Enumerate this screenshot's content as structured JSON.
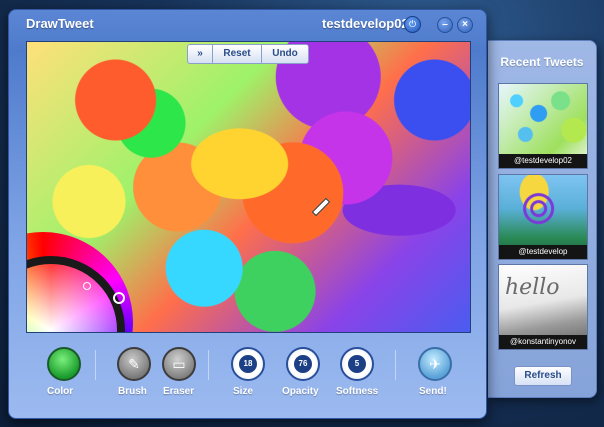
{
  "app": {
    "title": "DrawTweet",
    "username": "testdevelop02"
  },
  "canvas_toolbar": {
    "more": "»",
    "reset": "Reset",
    "undo": "Undo"
  },
  "tools": {
    "color": "Color",
    "brush": "Brush",
    "eraser": "Eraser",
    "size": {
      "label": "Size",
      "value": "18"
    },
    "opacity": {
      "label": "Opacity",
      "value": "76"
    },
    "softness": {
      "label": "Softness",
      "value": "5"
    },
    "send": "Send!"
  },
  "recent": {
    "title": "Recent Tweets",
    "items": [
      {
        "user": "@testdevelop02"
      },
      {
        "user": "@testdevelop"
      },
      {
        "user": "@konstantinyonov",
        "scribble": "hello"
      }
    ],
    "refresh": "Refresh"
  }
}
